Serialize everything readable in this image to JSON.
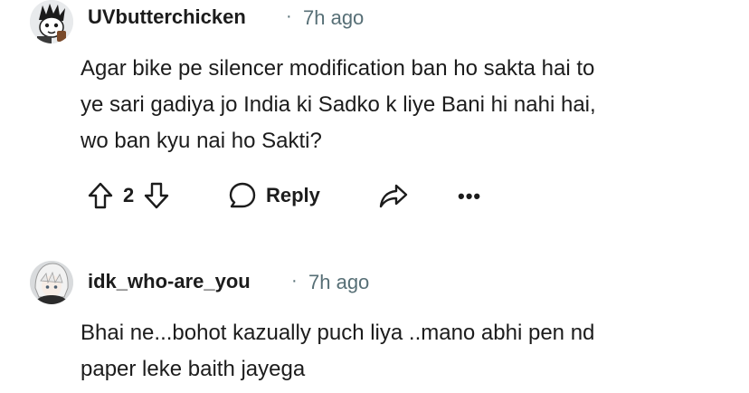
{
  "comments": [
    {
      "username": "UVbutterchicken",
      "separator": "·",
      "time": "7h ago",
      "avatar_icon": "cartoon-avatar-icon",
      "body_lines": [
        "Agar bike pe silencer modification ban ho sakta hai to",
        "ye sari gadiya jo India ki Sadko k liye Bani hi nahi hai,",
        "wo ban kyu nai ho Sakti?"
      ],
      "votes": "2",
      "reply_label": "Reply",
      "more_label": "•••"
    },
    {
      "username": "idk_who-are_you",
      "separator": "·",
      "time": "7h ago",
      "avatar_icon": "anime-avatar-icon",
      "body_lines": [
        "Bhai ne...bohot kazually puch liya ..mano abhi pen nd",
        "paper leke baith jayega"
      ]
    }
  ],
  "colors": {
    "text": "#1c1c1c",
    "meta": "#576f76"
  }
}
